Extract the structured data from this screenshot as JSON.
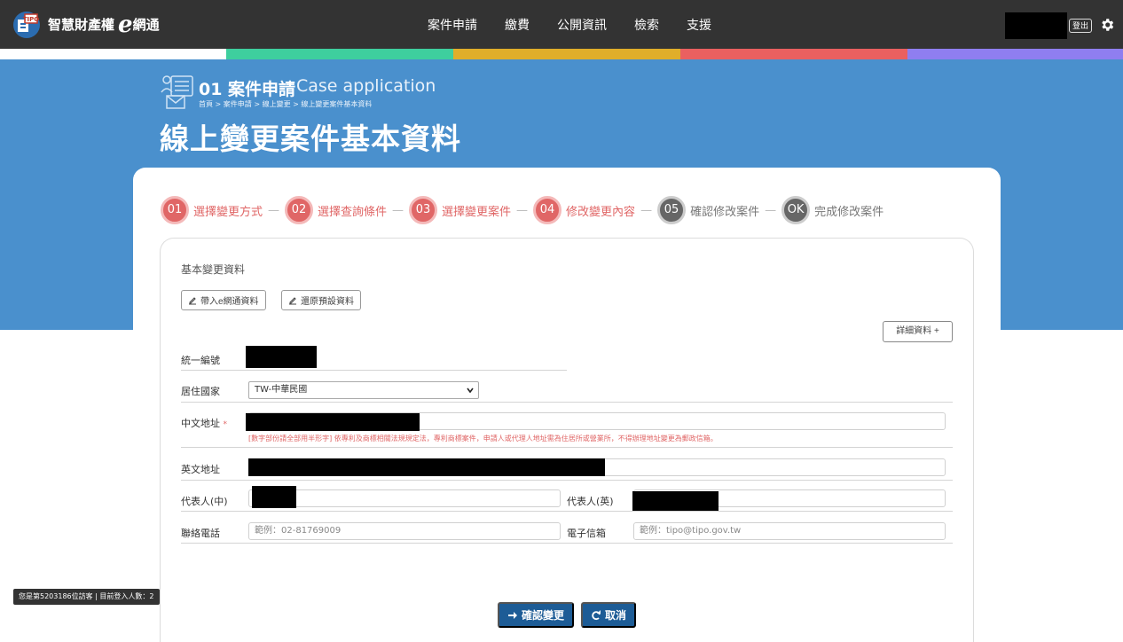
{
  "header": {
    "logo_text": "智慧財產權",
    "logo_e": "e",
    "logo_suffix": "網通",
    "nav": [
      {
        "label": "案件申請"
      },
      {
        "label": "繳費"
      },
      {
        "label": "公開資訊"
      },
      {
        "label": "檢索"
      },
      {
        "label": "支援"
      }
    ],
    "logout_label": "登出"
  },
  "colors": {
    "stripe": [
      "#3ecf9e",
      "#e0ae2a",
      "#ea6060",
      "#8f7ef0"
    ],
    "hero": "#4a90cd",
    "accent": "#e06666",
    "primary": "#1d5c96"
  },
  "hero": {
    "section_number": "01 案件申請",
    "section_en": "Case application",
    "breadcrumb": "首頁 > 案件申請 > 線上變更 > 線上變更案件基本資料",
    "title": "線上變更案件基本資料"
  },
  "steps": [
    {
      "no": "01",
      "label": "選擇變更方式",
      "state": "done"
    },
    {
      "no": "02",
      "label": "選擇查詢條件",
      "state": "done"
    },
    {
      "no": "03",
      "label": "選擇變更案件",
      "state": "done"
    },
    {
      "no": "04",
      "label": "修改變更內容",
      "state": "done"
    },
    {
      "no": "05",
      "label": "確認修改案件",
      "state": "todo"
    },
    {
      "no": "OK",
      "label": "完成修改案件",
      "state": "todo"
    }
  ],
  "step_separator": "—",
  "form": {
    "heading": "基本變更資料",
    "import_button": "帶入e網通資料",
    "reset_button": "還原預設資料",
    "detail_button": "詳細資料 +",
    "tax_id_label": "統一編號",
    "country_label": "居住國家",
    "country_value": "TW-中華民國",
    "cn_address_label": "中文地址",
    "required_mark": "*",
    "address_note": "[數字部份請全部用半形字] 依專利及商標相關法規規定法，專利商標案件，申請人或代理人地址需為住居所或營業所，不得辦理地址變更為郵政信箱。",
    "en_address_label": "英文地址",
    "rep_cn_label": "代表人(中)",
    "rep_en_label": "代表人(英)",
    "phone_label": "聯絡電話",
    "phone_placeholder": "範例：02-81769009",
    "email_label": "電子信箱",
    "email_placeholder": "範例：tipo@tipo.gov.tw"
  },
  "actions": {
    "confirm_label": "確認變更",
    "cancel_label": "取消"
  },
  "visitor_text": "您是第5203186位訪客 | 目前登入人數：2"
}
